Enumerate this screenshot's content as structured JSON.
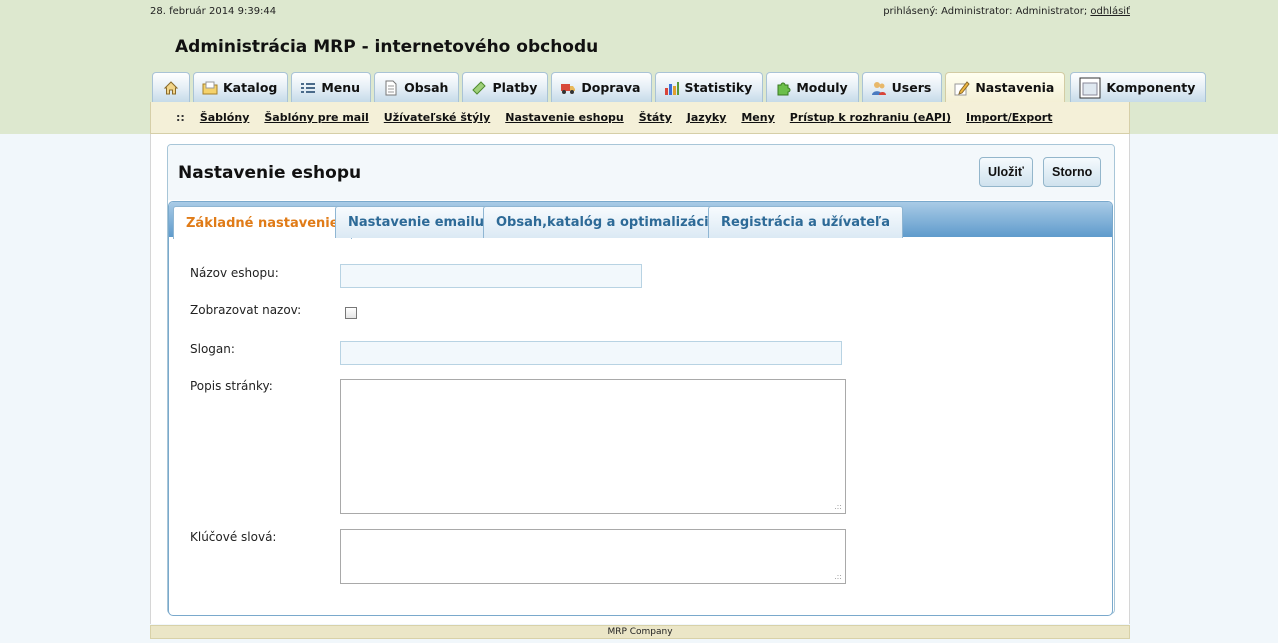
{
  "header": {
    "datetime": "28. február 2014 9:39:44",
    "login_prefix": "prihlásený: Administrator: Administrator;",
    "logout_label": "odhlásiť",
    "app_title": "Administrácia MRP - internetového obchodu"
  },
  "main_tabs": [
    {
      "label": "",
      "icon": "home-icon"
    },
    {
      "label": "Katalog",
      "icon": "folder-icon"
    },
    {
      "label": "Menu",
      "icon": "list-icon"
    },
    {
      "label": "Obsah",
      "icon": "document-icon"
    },
    {
      "label": "Platby",
      "icon": "ticket-icon"
    },
    {
      "label": "Doprava",
      "icon": "truck-icon"
    },
    {
      "label": "Statistiky",
      "icon": "bar-chart-icon"
    },
    {
      "label": "Moduly",
      "icon": "puzzle-icon"
    },
    {
      "label": "Users",
      "icon": "users-icon"
    },
    {
      "label": "Nastavenia",
      "icon": "settings-pencil-icon",
      "active": true
    },
    {
      "label": "Komponenty",
      "icon": "window-icon"
    }
  ],
  "subnav": {
    "prefix": "::",
    "links": [
      "Šablóny",
      "Šablóny pre mail",
      "Užívateľské štýly",
      "Nastavenie eshopu",
      "Štáty",
      "Jazyky",
      "Meny",
      "Prístup k rozhraniu (eAPI)",
      "Import/Export"
    ]
  },
  "page": {
    "title": "Nastavenie eshopu",
    "save_label": "Uložiť",
    "cancel_label": "Storno"
  },
  "tabs": [
    {
      "label": "Základné nastavenie",
      "active": true
    },
    {
      "label": "Nastavenie emailu"
    },
    {
      "label": "Obsah,katalóg a optimalizácia"
    },
    {
      "label": "Registrácia a užívateľa"
    }
  ],
  "form": {
    "shop_name_label": "Názov eshopu:",
    "shop_name_value": "",
    "show_name_label": "Zobrazovat nazov:",
    "show_name_checked": false,
    "slogan_label": "Slogan:",
    "slogan_value": "",
    "description_label": "Popis stránky:",
    "description_value": "",
    "keywords_label": "Klúčové slová:",
    "keywords_value": ""
  },
  "footer": {
    "text": "MRP Company"
  },
  "colors": {
    "top_band": "#dde8cf",
    "active_tab_text": "#e07b17",
    "tab_text": "#2d6a97"
  }
}
